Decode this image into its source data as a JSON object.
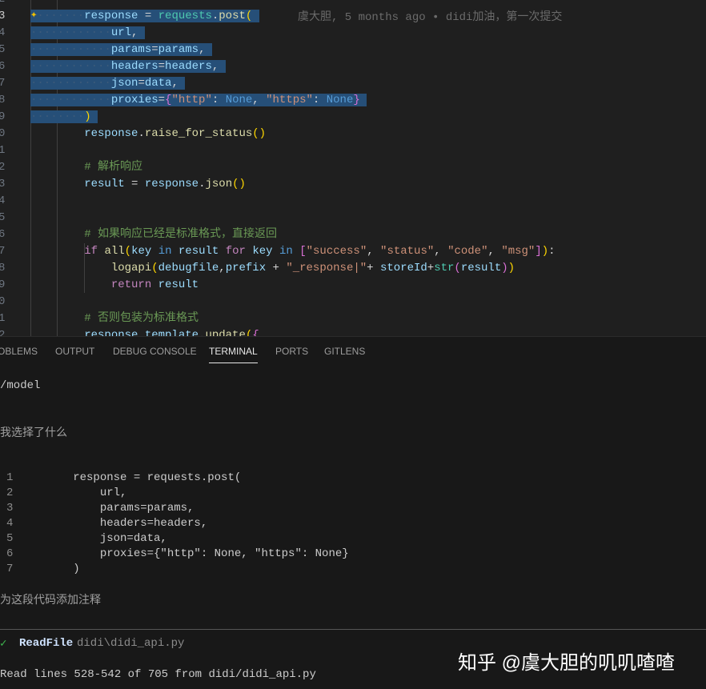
{
  "editor": {
    "line_numbers": [
      "2",
      "3",
      "4",
      "5",
      "6",
      "7",
      "8",
      "9",
      "0",
      "1",
      "2",
      "3",
      "4",
      "5",
      "6",
      "7",
      "8",
      "9",
      "0",
      "1",
      "2"
    ],
    "lines": [
      [],
      [
        [
          "ws",
          "········"
        ],
        [
          "var",
          "response"
        ],
        [
          "op",
          " = "
        ],
        [
          "cls",
          "requests"
        ],
        [
          "op",
          "."
        ],
        [
          "fn",
          "post"
        ],
        [
          "p1",
          "("
        ]
      ],
      [
        [
          "ws",
          "············"
        ],
        [
          "var",
          "url"
        ],
        [
          "op",
          ","
        ]
      ],
      [
        [
          "ws",
          "············"
        ],
        [
          "var",
          "params"
        ],
        [
          "op",
          "="
        ],
        [
          "var",
          "params"
        ],
        [
          "op",
          ","
        ]
      ],
      [
        [
          "ws",
          "············"
        ],
        [
          "var",
          "headers"
        ],
        [
          "op",
          "="
        ],
        [
          "var",
          "headers"
        ],
        [
          "op",
          ","
        ]
      ],
      [
        [
          "ws",
          "············"
        ],
        [
          "var",
          "json"
        ],
        [
          "op",
          "="
        ],
        [
          "var",
          "data"
        ],
        [
          "op",
          ","
        ]
      ],
      [
        [
          "ws",
          "············"
        ],
        [
          "var",
          "proxies"
        ],
        [
          "op",
          "="
        ],
        [
          "p2",
          "{"
        ],
        [
          "str",
          "\"http\""
        ],
        [
          "op",
          ": "
        ],
        [
          "kw",
          "None"
        ],
        [
          "op",
          ", "
        ],
        [
          "str",
          "\"https\""
        ],
        [
          "op",
          ": "
        ],
        [
          "kw",
          "None"
        ],
        [
          "p2",
          "}"
        ]
      ],
      [
        [
          "ws",
          "········"
        ],
        [
          "p1",
          ")"
        ]
      ],
      [
        [
          "op",
          "        "
        ],
        [
          "var",
          "response"
        ],
        [
          "op",
          "."
        ],
        [
          "fn",
          "raise_for_status"
        ],
        [
          "p1",
          "()"
        ]
      ],
      [],
      [
        [
          "op",
          "        "
        ],
        [
          "cm",
          "# 解析响应"
        ]
      ],
      [
        [
          "op",
          "        "
        ],
        [
          "var",
          "result"
        ],
        [
          "op",
          " = "
        ],
        [
          "var",
          "response"
        ],
        [
          "op",
          "."
        ],
        [
          "fn",
          "json"
        ],
        [
          "p1",
          "()"
        ]
      ],
      [],
      [],
      [
        [
          "op",
          "        "
        ],
        [
          "cm",
          "# 如果响应已经是标准格式，直接返回"
        ]
      ],
      [
        [
          "op",
          "        "
        ],
        [
          "ctl",
          "if"
        ],
        [
          "op",
          " "
        ],
        [
          "fn",
          "all"
        ],
        [
          "p1",
          "("
        ],
        [
          "var",
          "key"
        ],
        [
          "op",
          " "
        ],
        [
          "kw",
          "in"
        ],
        [
          "op",
          " "
        ],
        [
          "var",
          "result"
        ],
        [
          "op",
          " "
        ],
        [
          "ctl",
          "for"
        ],
        [
          "op",
          " "
        ],
        [
          "var",
          "key"
        ],
        [
          "op",
          " "
        ],
        [
          "kw",
          "in"
        ],
        [
          "op",
          " "
        ],
        [
          "p2",
          "["
        ],
        [
          "str",
          "\"success\""
        ],
        [
          "op",
          ", "
        ],
        [
          "str",
          "\"status\""
        ],
        [
          "op",
          ", "
        ],
        [
          "str",
          "\"code\""
        ],
        [
          "op",
          ", "
        ],
        [
          "str",
          "\"msg\""
        ],
        [
          "p2",
          "]"
        ],
        [
          "p1",
          ")"
        ],
        [
          "op",
          ":"
        ]
      ],
      [
        [
          "op",
          "            "
        ],
        [
          "fn",
          "logapi"
        ],
        [
          "p1",
          "("
        ],
        [
          "var",
          "debugfile"
        ],
        [
          "op",
          ","
        ],
        [
          "var",
          "prefix"
        ],
        [
          "op",
          " + "
        ],
        [
          "str",
          "\"_response|\""
        ],
        [
          "op",
          "+ "
        ],
        [
          "var",
          "storeId"
        ],
        [
          "op",
          "+"
        ],
        [
          "cls",
          "str"
        ],
        [
          "p2",
          "("
        ],
        [
          "var",
          "result"
        ],
        [
          "p2",
          ")"
        ],
        [
          "p1",
          ")"
        ]
      ],
      [
        [
          "op",
          "            "
        ],
        [
          "ctl",
          "return"
        ],
        [
          "op",
          " "
        ],
        [
          "var",
          "result"
        ]
      ],
      [],
      [
        [
          "op",
          "        "
        ],
        [
          "cm",
          "# 否则包装为标准格式"
        ]
      ],
      [
        [
          "op",
          "        "
        ],
        [
          "var",
          "response_template"
        ],
        [
          "op",
          "."
        ],
        [
          "fn",
          "update"
        ],
        [
          "p1",
          "("
        ],
        [
          "p2",
          "{"
        ]
      ]
    ],
    "selected_range": [
      1,
      7
    ],
    "blame": "虞大胆, 5 months ago • didi加油，第一次提交"
  },
  "panel": {
    "tabs": [
      "OBLEMS",
      "OUTPUT",
      "DEBUG CONSOLE",
      "TERMINAL",
      "PORTS",
      "GITLENS"
    ],
    "active_tab": "TERMINAL"
  },
  "terminal": {
    "command": "/model",
    "question": "我选择了什么",
    "snippet": [
      {
        "n": "1",
        "text": "        response = requests.post("
      },
      {
        "n": "2",
        "text": "            url,"
      },
      {
        "n": "3",
        "text": "            params=params,"
      },
      {
        "n": "4",
        "text": "            headers=headers,"
      },
      {
        "n": "5",
        "text": "            json=data,"
      },
      {
        "n": "6",
        "text": "            proxies={\"http\": None, \"https\": None}"
      },
      {
        "n": "7",
        "text": "        )"
      }
    ],
    "prompt": "为这段代码添加注释",
    "tool_check": "✓",
    "tool_name": "ReadFile",
    "tool_arg": "didi\\didi_api.py",
    "tool_result": "Read lines 528-542 of 705 from didi/didi_api.py"
  },
  "watermark": "知乎 @虞大胆的叽叽喳喳"
}
